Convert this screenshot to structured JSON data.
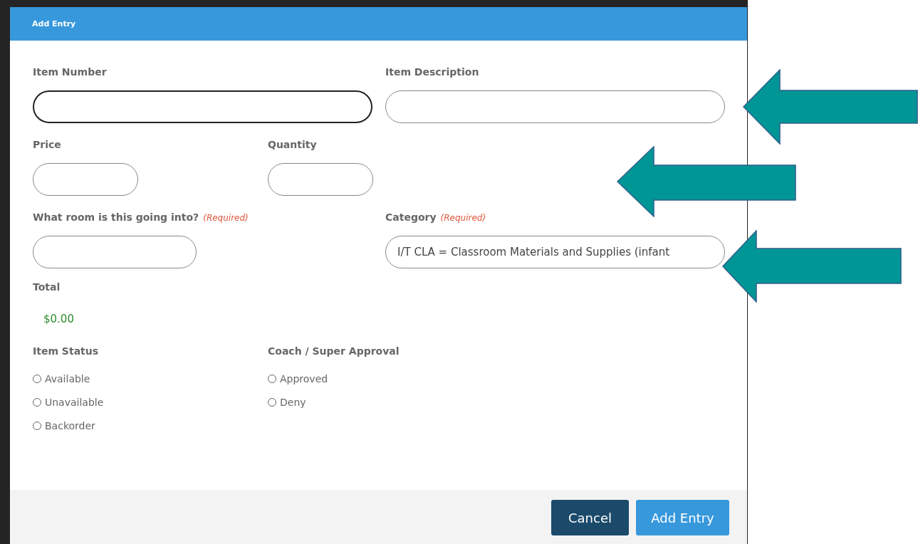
{
  "dialog": {
    "title": "Add Entry"
  },
  "item_number": {
    "label": "Item Number",
    "focused": true
  },
  "item_description": {
    "label": "Item Description",
    "focused": false
  },
  "price": {
    "label": "Price",
    "focused": false
  },
  "quantity": {
    "label": "Quantity",
    "focused": false
  },
  "room": {
    "label": "What room is this going into?",
    "required_note": "(Required)",
    "focused": false
  },
  "category": {
    "label": "Category",
    "required_note": "(Required)",
    "value": "I/T CLA = Classroom Materials and Supplies (infant",
    "focused": false
  },
  "total": {
    "label": "Total",
    "value": "$0.00"
  },
  "item_status": {
    "label": "Item Status",
    "options": [
      {
        "label": "Available",
        "selected": false
      },
      {
        "label": "Unavailable",
        "selected": false
      },
      {
        "label": "Backorder",
        "selected": false
      }
    ]
  },
  "approval": {
    "label": "Coach / Super Approval",
    "options": [
      {
        "label": "Approved",
        "selected": false
      },
      {
        "label": "Deny",
        "selected": false
      }
    ]
  },
  "buttons": [
    {
      "label": "Cancel",
      "kind": "secondary"
    },
    {
      "label": "Add Entry",
      "kind": "primary"
    }
  ]
}
